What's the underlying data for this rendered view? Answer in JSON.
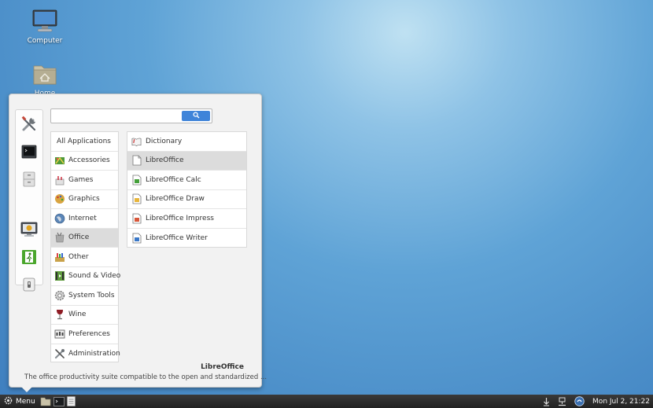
{
  "desktop": {
    "icons": [
      {
        "label": "Computer",
        "icon": "monitor-icon"
      },
      {
        "label": "Home",
        "icon": "home-folder-icon"
      }
    ]
  },
  "menu": {
    "search": {
      "value": "",
      "placeholder": "",
      "button_icon": "search-icon"
    },
    "favorites": [
      {
        "icon": "system-tools-icon"
      },
      {
        "icon": "terminal-icon"
      },
      {
        "icon": "file-cabinet-icon"
      },
      {
        "icon": "screen-lock-icon"
      },
      {
        "icon": "logout-icon"
      },
      {
        "icon": "shutdown-icon"
      }
    ],
    "categories": [
      {
        "label": "All Applications",
        "icon": ""
      },
      {
        "label": "Accessories",
        "icon": "accessories-icon"
      },
      {
        "label": "Games",
        "icon": "games-icon"
      },
      {
        "label": "Graphics",
        "icon": "graphics-icon"
      },
      {
        "label": "Internet",
        "icon": "globe-icon"
      },
      {
        "label": "Office",
        "icon": "office-icon"
      },
      {
        "label": "Other",
        "icon": "other-icon"
      },
      {
        "label": "Sound & Video",
        "icon": "media-icon"
      },
      {
        "label": "System Tools",
        "icon": "gear-icon"
      },
      {
        "label": "Wine",
        "icon": "wine-glass-icon"
      },
      {
        "label": "Preferences",
        "icon": "preferences-icon"
      },
      {
        "label": "Administration",
        "icon": "tools-icon"
      }
    ],
    "selected_category": "Office",
    "apps": [
      {
        "label": "Dictionary",
        "icon": "dictionary-icon"
      },
      {
        "label": "LibreOffice",
        "icon": "libreoffice-icon"
      },
      {
        "label": "LibreOffice Calc",
        "icon": "spreadsheet-icon"
      },
      {
        "label": "LibreOffice Draw",
        "icon": "drawing-icon"
      },
      {
        "label": "LibreOffice Impress",
        "icon": "presentation-icon"
      },
      {
        "label": "LibreOffice Writer",
        "icon": "document-icon"
      }
    ],
    "selected_app": "LibreOffice",
    "description": {
      "title": "LibreOffice",
      "text": "The office productivity suite compatible to the open and standardized ..."
    }
  },
  "taskbar": {
    "menu_label": "Menu",
    "menu_icon": "gear-icon",
    "launchers": [
      {
        "icon": "file-manager-icon"
      },
      {
        "icon": "terminal-icon"
      },
      {
        "icon": "text-editor-icon"
      }
    ],
    "tray": [
      {
        "icon": "updates-icon"
      },
      {
        "icon": "network-icon"
      },
      {
        "icon": "update-manager-icon"
      }
    ],
    "clock": "Mon Jul  2, 21:22"
  },
  "colors": {
    "accent": "#3f84d9",
    "selected_row": "#dcdcdc",
    "panel_bg": "#f2f2f2",
    "taskbar_bg": "#2b2b2b"
  }
}
